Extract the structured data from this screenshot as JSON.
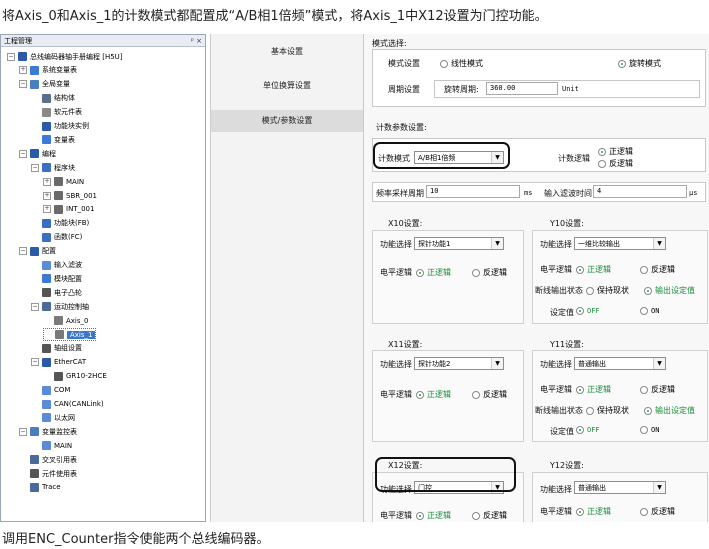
{
  "intro_text": "将Axis_0和Axis_1的计数模式都配置成“A/B相1倍频”模式，将Axis_1中X12设置为门控功能。",
  "footer_text": "调用ENC_Counter指令使能两个总线编码器。",
  "tree": {
    "title": "工程管理",
    "pin": "ᵖ",
    "close": "×",
    "items": [
      {
        "label": "总线编码器轴手册编程 [H5U]"
      },
      {
        "label": "系统变量表"
      },
      {
        "label": "全局变量"
      },
      {
        "label": "结构体"
      },
      {
        "label": "软元件表"
      },
      {
        "label": "功能块实例"
      },
      {
        "label": "变量表"
      },
      {
        "label": "编程"
      },
      {
        "label": "程序块"
      },
      {
        "label": "MAIN"
      },
      {
        "label": "SBR_001"
      },
      {
        "label": "INT_001"
      },
      {
        "label": "功能块(FB)"
      },
      {
        "label": "函数(FC)"
      },
      {
        "label": "配置"
      },
      {
        "label": "输入滤波"
      },
      {
        "label": "模块配置"
      },
      {
        "label": "电子凸轮"
      },
      {
        "label": "运动控制轴"
      },
      {
        "label": "Axis_0"
      },
      {
        "label": "Axis_1"
      },
      {
        "label": "轴组设置"
      },
      {
        "label": "EtherCAT"
      },
      {
        "label": "GR10-2HCE"
      },
      {
        "label": "COM"
      },
      {
        "label": "CAN(CANLink)"
      },
      {
        "label": "以太网"
      },
      {
        "label": "变量监控表"
      },
      {
        "label": "MAIN"
      },
      {
        "label": "交叉引用表"
      },
      {
        "label": "元件使用表"
      },
      {
        "label": "Trace"
      }
    ]
  },
  "nav": {
    "basic": "基本设置",
    "unit": "单位换算设置",
    "mode": "模式/参数设置"
  },
  "mode_select": {
    "title": "模式选择:",
    "mode_label": "模式设置",
    "linear": "线性模式",
    "rotary": "旋转模式",
    "period_label": "周期设置",
    "period_field_label": "旋转周期:",
    "period_value": "360.00",
    "period_unit": "Unit"
  },
  "count_params": {
    "title": "计数参数设置:",
    "mode_label": "计数模式",
    "mode_value": "A/B相1倍频",
    "logic_label": "计数逻辑",
    "logic_pos": "正逻辑",
    "logic_neg": "反逻辑",
    "freq_label": "频率采样周期",
    "freq_value": "10",
    "freq_unit": "ms",
    "filter_label": "输入滤波时间",
    "filter_value": "4",
    "filter_unit": "μs"
  },
  "x10": {
    "title": "X10设置:",
    "func_label": "功能选择",
    "func_value": "探针功能1",
    "level_label": "电平逻辑",
    "pos": "正逻辑",
    "neg": "反逻辑"
  },
  "y10": {
    "title": "Y10设置:",
    "func_label": "功能选择",
    "func_value": "一维比较输出",
    "level_label": "电平逻辑",
    "pos": "正逻辑",
    "neg": "反逻辑",
    "break_label": "断线输出状态",
    "keep": "保持现状",
    "output_set": "输出设定值",
    "setval_label": "设定值",
    "off": "OFF",
    "on": "ON"
  },
  "x11": {
    "title": "X11设置:",
    "func_label": "功能选择",
    "func_value": "探针功能2",
    "level_label": "电平逻辑",
    "pos": "正逻辑",
    "neg": "反逻辑"
  },
  "y11": {
    "title": "Y11设置:",
    "func_label": "功能选择",
    "func_value": "普通输出",
    "level_label": "电平逻辑",
    "pos": "正逻辑",
    "neg": "反逻辑",
    "break_label": "断线输出状态",
    "keep": "保持现状",
    "output_set": "输出设定值",
    "setval_label": "设定值",
    "off": "OFF",
    "on": "ON"
  },
  "x12": {
    "title": "X12设置:",
    "func_label": "功能选择",
    "func_value": "门控",
    "level_label": "电平逻辑",
    "pos": "正逻辑",
    "neg": "反逻辑"
  },
  "y12": {
    "title": "Y12设置:",
    "func_label": "功能选择",
    "func_value": "普通输出",
    "level_label": "电平逻辑",
    "pos": "正逻辑",
    "neg": "反逻辑"
  },
  "colors": {
    "accent": "#3a78c9",
    "radio_on": "#1aa34a",
    "highlight": "#111111"
  }
}
